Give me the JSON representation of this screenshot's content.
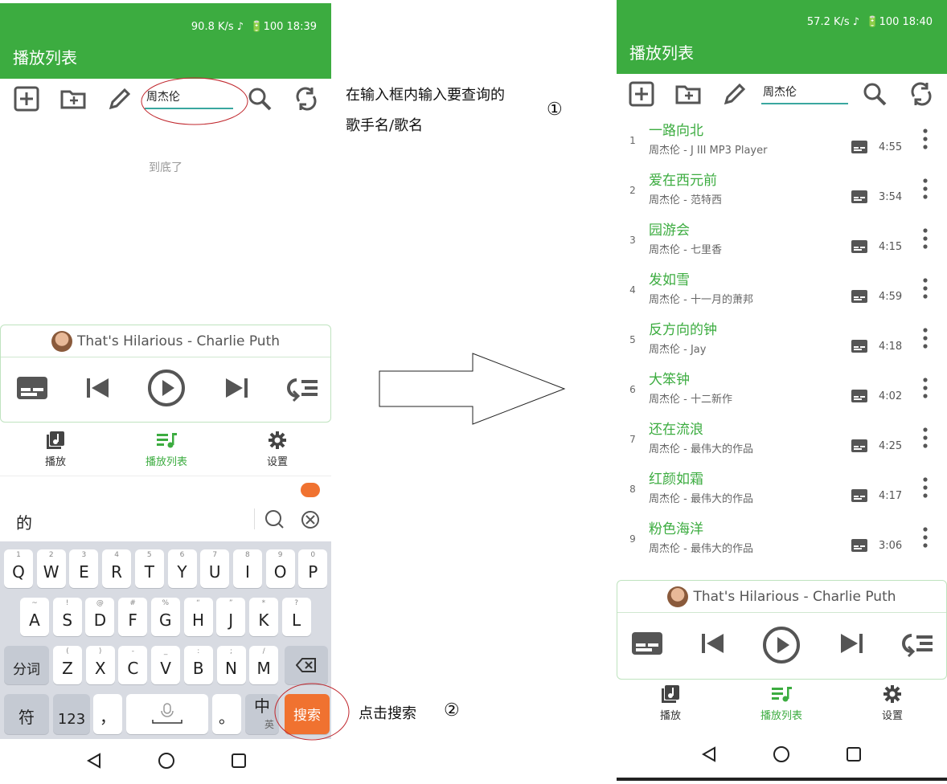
{
  "colors": {
    "accent": "#3cac40",
    "search_key": "#f07230",
    "annotation": "#c0262c"
  },
  "left_phone": {
    "status": {
      "speed": "90.8 K/s",
      "battery": "100",
      "time": "18:39"
    },
    "title": "播放列表",
    "search_value": "周杰伦",
    "empty_text": "到底了",
    "now_playing": "That's Hilarious - Charlie Puth",
    "tabs": [
      {
        "label": "播放"
      },
      {
        "label": "播放列表"
      },
      {
        "label": "设置"
      }
    ],
    "ime_candidate": "的",
    "keyboard": {
      "row1": [
        {
          "k": "Q",
          "s": "1"
        },
        {
          "k": "W",
          "s": "2"
        },
        {
          "k": "E",
          "s": "3"
        },
        {
          "k": "R",
          "s": "4"
        },
        {
          "k": "T",
          "s": "5"
        },
        {
          "k": "Y",
          "s": "6"
        },
        {
          "k": "U",
          "s": "7"
        },
        {
          "k": "I",
          "s": "8"
        },
        {
          "k": "O",
          "s": "9"
        },
        {
          "k": "P",
          "s": "0"
        }
      ],
      "row2": [
        {
          "k": "A",
          "s": "~"
        },
        {
          "k": "S",
          "s": "!"
        },
        {
          "k": "D",
          "s": "@"
        },
        {
          "k": "F",
          "s": "#"
        },
        {
          "k": "G",
          "s": "%"
        },
        {
          "k": "H",
          "s": "“"
        },
        {
          "k": "J",
          "s": "”"
        },
        {
          "k": "K",
          "s": "*"
        },
        {
          "k": "L",
          "s": "?"
        }
      ],
      "row3": [
        {
          "k": "Z",
          "s": "("
        },
        {
          "k": "X",
          "s": ")"
        },
        {
          "k": "C",
          "s": "-"
        },
        {
          "k": "V",
          "s": "_"
        },
        {
          "k": "B",
          "s": ":"
        },
        {
          "k": "N",
          "s": ";"
        },
        {
          "k": "M",
          "s": "/"
        }
      ],
      "fenci": "分词",
      "fu": "符",
      "num": "123",
      "comma": "，",
      "period": "。",
      "zhong": "中",
      "ying": "英",
      "search": "搜索"
    }
  },
  "annotations": {
    "step1_line1": "在输入框内输入要查询的",
    "step1_line2": "歌手名/歌名",
    "step1_num": "①",
    "step2": "点击搜索",
    "step2_num": "②"
  },
  "right_phone": {
    "status": {
      "speed": "57.2 K/s",
      "battery": "100",
      "time": "18:40"
    },
    "title": "播放列表",
    "search_value": "周杰伦",
    "now_playing": "That's Hilarious - Charlie Puth",
    "tabs": [
      {
        "label": "播放"
      },
      {
        "label": "播放列表"
      },
      {
        "label": "设置"
      }
    ],
    "songs": [
      {
        "num": "1",
        "title": "一路向北",
        "sub": "周杰伦 - J III MP3 Player",
        "dur": "4:55"
      },
      {
        "num": "2",
        "title": "爱在西元前",
        "sub": "周杰伦 - 范特西",
        "dur": "3:54"
      },
      {
        "num": "3",
        "title": "园游会",
        "sub": "周杰伦 - 七里香",
        "dur": "4:15"
      },
      {
        "num": "4",
        "title": "发如雪",
        "sub": "周杰伦 - 十一月的萧邦",
        "dur": "4:59"
      },
      {
        "num": "5",
        "title": "反方向的钟",
        "sub": "周杰伦 - Jay",
        "dur": "4:18"
      },
      {
        "num": "6",
        "title": "大笨钟",
        "sub": "周杰伦 - 十二新作",
        "dur": "4:02"
      },
      {
        "num": "7",
        "title": "还在流浪",
        "sub": "周杰伦 - 最伟大的作品",
        "dur": "4:25"
      },
      {
        "num": "8",
        "title": "红颜如霜",
        "sub": "周杰伦 - 最伟大的作品",
        "dur": "4:17"
      },
      {
        "num": "9",
        "title": "粉色海洋",
        "sub": "周杰伦 - 最伟大的作品",
        "dur": "3:06"
      }
    ]
  }
}
